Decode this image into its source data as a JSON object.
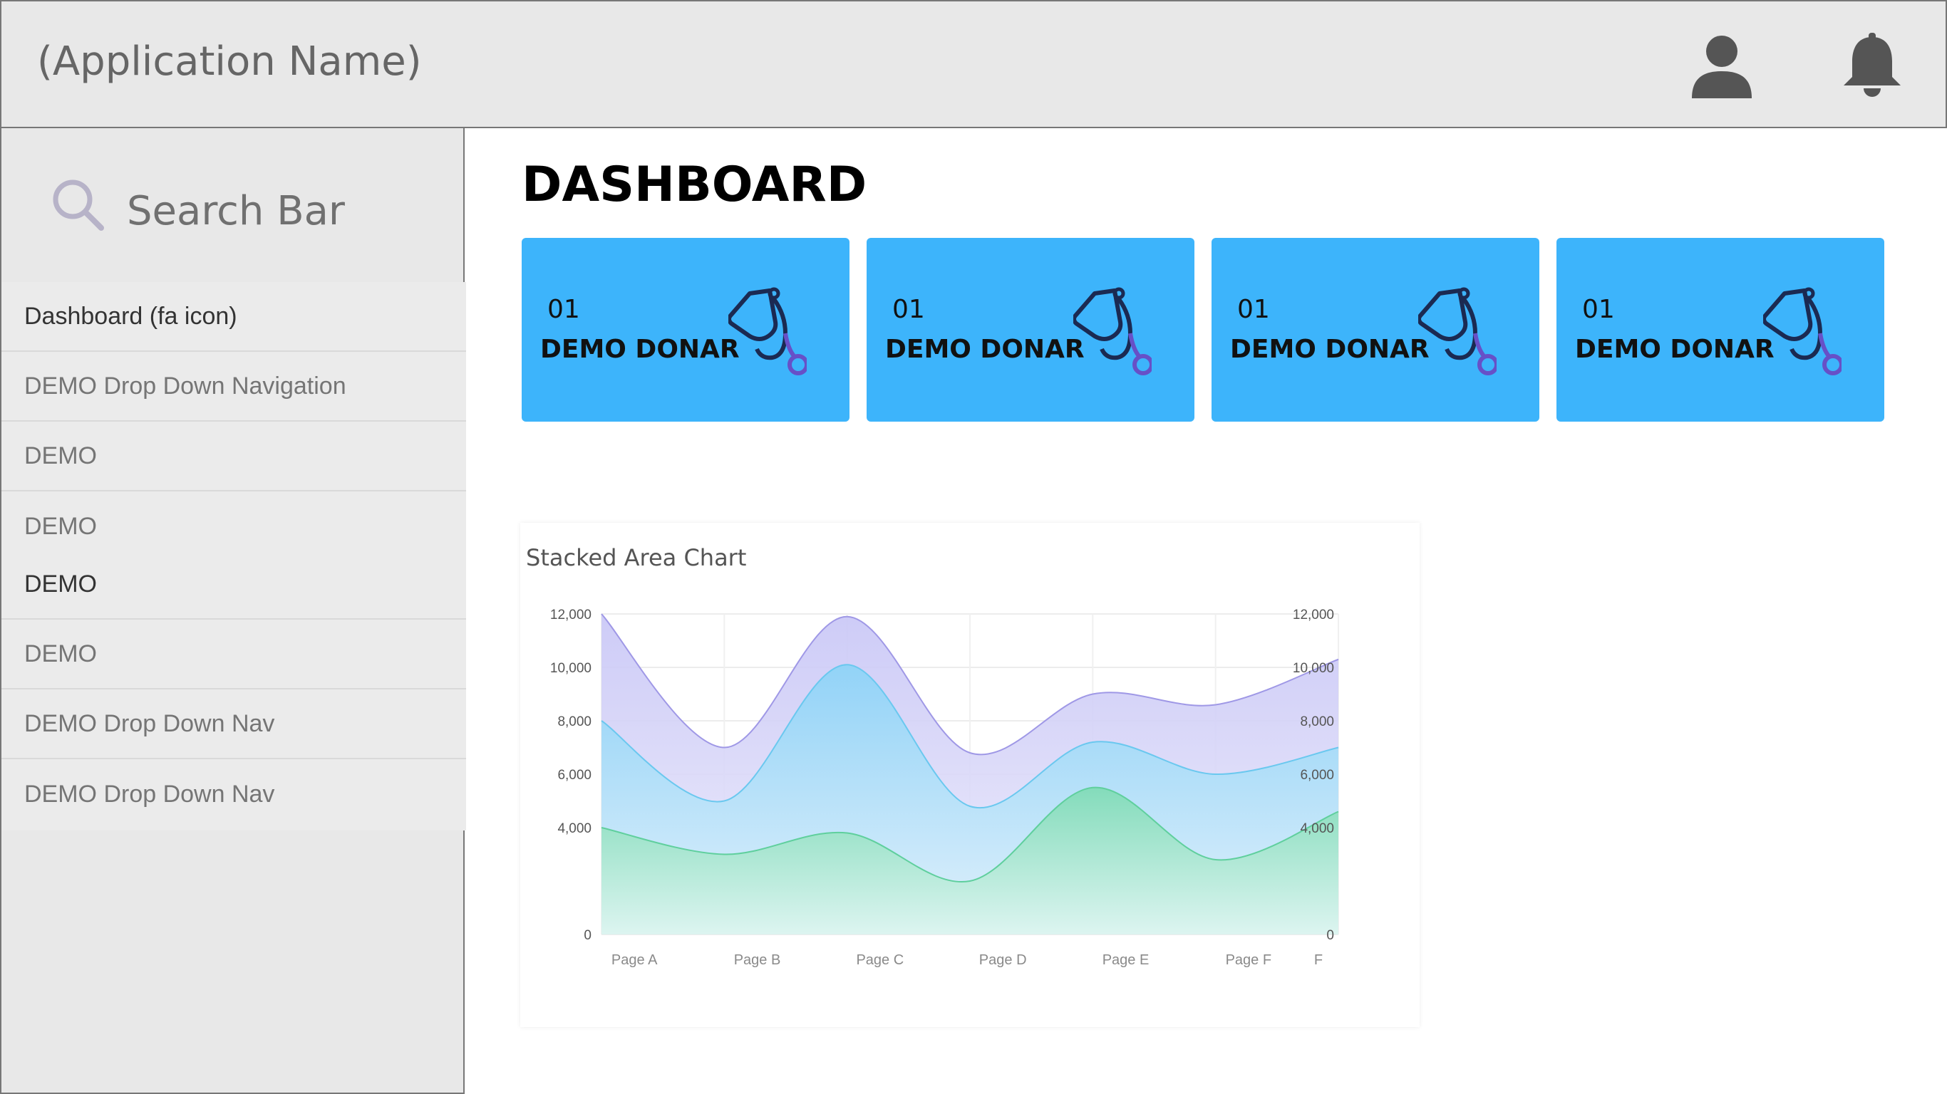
{
  "header": {
    "app_name": "(Application Name)",
    "icons": [
      "user-icon",
      "bell-icon"
    ]
  },
  "sidebar": {
    "search_label": "Search Bar",
    "items": [
      {
        "label": "Dashboard (fa icon)",
        "active": true
      },
      {
        "label": "DEMO Drop Down Navigation",
        "active": false
      },
      {
        "label": "DEMO",
        "active": false
      },
      {
        "label": "DEMO",
        "active": false
      },
      {
        "label": "DEMO",
        "active": true
      },
      {
        "label": "DEMO",
        "active": false
      },
      {
        "label": "DEMO Drop Down Nav",
        "active": false
      },
      {
        "label": "DEMO Drop Down Nav",
        "active": false
      }
    ]
  },
  "main": {
    "title": "DASHBOARD",
    "cards": [
      {
        "number": "01",
        "label": "DEMO DONAR",
        "icon": "stethoscope-icon"
      },
      {
        "number": "01",
        "label": "DEMO DONAR",
        "icon": "stethoscope-icon"
      },
      {
        "number": "01",
        "label": "DEMO DONAR",
        "icon": "stethoscope-icon"
      },
      {
        "number": "01",
        "label": "DEMO DONAR",
        "icon": "stethoscope-icon"
      }
    ]
  },
  "colors": {
    "card": "#3db4fb",
    "series_green": "#7edbb4",
    "series_blue": "#8bd3f7",
    "series_purple": "#c8c6f6"
  },
  "chart_data": {
    "type": "area",
    "title": "Stacked Area Chart",
    "categories": [
      "Page A",
      "Page B",
      "Page C",
      "Page D",
      "Page E",
      "Page F",
      "F"
    ],
    "ylim": [
      0,
      12000
    ],
    "yticks": [
      "0",
      "4,000",
      "6,000",
      "8,000",
      "10,000",
      "12,000"
    ],
    "ytick_values": [
      0,
      4000,
      6000,
      8000,
      10000,
      12000
    ],
    "grid": true,
    "series": [
      {
        "values": [
          4000,
          3000,
          3800,
          2000,
          5500,
          2800,
          4600
        ]
      },
      {
        "values": [
          4000,
          2000,
          6300,
          2800,
          1700,
          3200,
          2400
        ]
      },
      {
        "values": [
          4000,
          2000,
          1800,
          2000,
          1800,
          2600,
          3300
        ]
      }
    ]
  }
}
